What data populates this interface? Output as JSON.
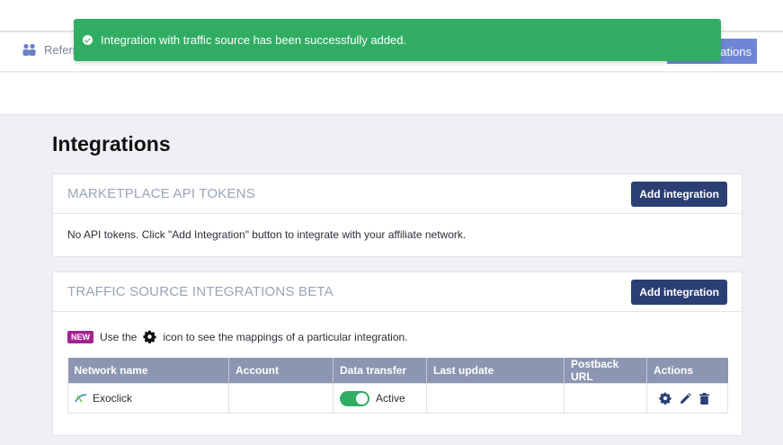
{
  "toast": {
    "message": "Integration with traffic source has been successfully added."
  },
  "subnav": {
    "referrals_label": "Referr",
    "active_tab_label": "rations"
  },
  "page": {
    "title": "Integrations"
  },
  "marketplace": {
    "title": "MARKETPLACE API TOKENS",
    "add_button": "Add integration",
    "empty_text": "No API tokens. Click \"Add Integration\" button to integrate with your affiliate network."
  },
  "traffic": {
    "title": "TRAFFIC SOURCE INTEGRATIONS BETA",
    "add_button": "Add integration",
    "badge": "NEW",
    "hint_before": "Use the",
    "hint_after": "icon to see the mappings of a particular integration.",
    "columns": [
      "Network name",
      "Account",
      "Data transfer",
      "Last update",
      "Postback URL",
      "Actions"
    ],
    "rows": [
      {
        "network": "Exoclick",
        "account": "",
        "data_transfer": "Active",
        "last_update": "",
        "postback_url": ""
      }
    ]
  },
  "colors": {
    "toast_bg": "#31ad63",
    "primary_button": "#2b3f75",
    "table_header": "#8c95b1",
    "badge_new": "#a2238f",
    "toggle_on": "#31ad63"
  }
}
